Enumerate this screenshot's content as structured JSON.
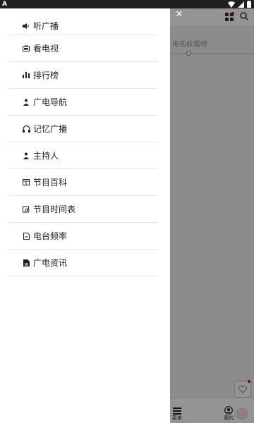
{
  "status_bar": {
    "left_label": "A"
  },
  "background_app": {
    "content_text": "电视收看榜",
    "bottom_tabs": [
      {
        "label": "菜单",
        "icon": "list-icon"
      },
      {
        "label": "我的",
        "icon": "user-icon"
      }
    ]
  },
  "drawer": {
    "close_icon": "close-icon",
    "items": [
      {
        "label": "听广播",
        "icon": "speaker-icon"
      },
      {
        "label": "看电视",
        "icon": "tv-icon"
      },
      {
        "label": "排行榜",
        "icon": "bar-chart-icon"
      },
      {
        "label": "广电导航",
        "icon": "person-icon"
      },
      {
        "label": "记忆广播",
        "icon": "headphones-icon"
      },
      {
        "label": "主持人",
        "icon": "person-icon"
      },
      {
        "label": "节目百科",
        "icon": "calendar-icon"
      },
      {
        "label": "节目时间表",
        "icon": "clock-calendar-icon"
      },
      {
        "label": "电台频率",
        "icon": "document-icon"
      },
      {
        "label": "广电资讯",
        "icon": "news-icon"
      }
    ]
  },
  "colors": {
    "accent": "#c0002e",
    "overlay": "rgba(0,0,0,0.42)"
  }
}
